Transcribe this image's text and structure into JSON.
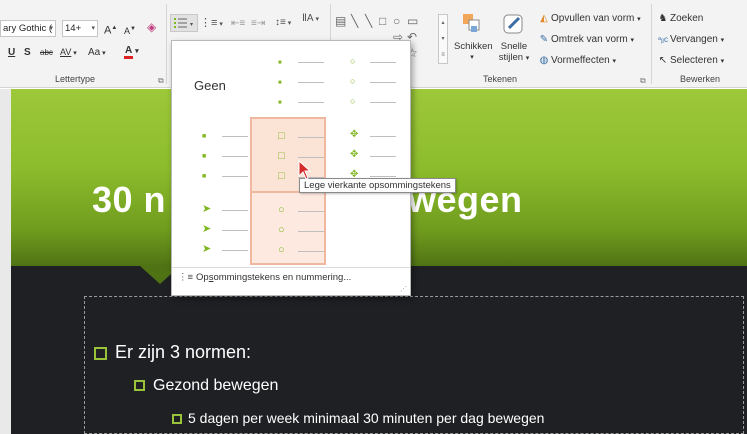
{
  "ribbon": {
    "font": {
      "font_name_value": "ary Gothic (",
      "font_size_value": "14+",
      "grow_label": "A",
      "shrink_label": "A",
      "underline_label": "U",
      "shadow_label": "S",
      "strike_label": "abc",
      "spacing_label": "AV",
      "case_label": "Aa",
      "color_label": "A",
      "group_label": "Lettertype"
    },
    "drawing": {
      "arrange_label": "Schikken",
      "quick_styles_label_line1": "Snelle",
      "quick_styles_label_line2": "stijlen",
      "fill_label": "Opvullen van vorm",
      "outline_label": "Omtrek van vorm",
      "effects_label": "Vormeffecten",
      "group_label": "Tekenen"
    },
    "editing": {
      "find_label": "Zoeken",
      "replace_label": "Vervangen",
      "select_label": "Selecteren",
      "group_label": "Bewerken"
    }
  },
  "bullet_gallery": {
    "none_label": "Geen",
    "footer_label_pre": "Op",
    "footer_label_underlined": "s",
    "footer_label_post": "ommingstekens en nummering...",
    "tooltip": "Lege vierkante opsommingstekens"
  },
  "slide": {
    "title_left": "30 n",
    "title_right": "wegen",
    "bullets": [
      {
        "level": 1,
        "text": "Er zijn 3 normen:"
      },
      {
        "level": 2,
        "text": "Gezond  bewegen"
      },
      {
        "level": 3,
        "text": "5 dagen per week minimaal 30 minuten per dag bewegen"
      }
    ]
  },
  "colors": {
    "accent_green": "#7fb71f",
    "title_band_green": "#8cbc2c",
    "slide_dark": "#1f2023",
    "highlight_border": "#f0b8a0"
  }
}
